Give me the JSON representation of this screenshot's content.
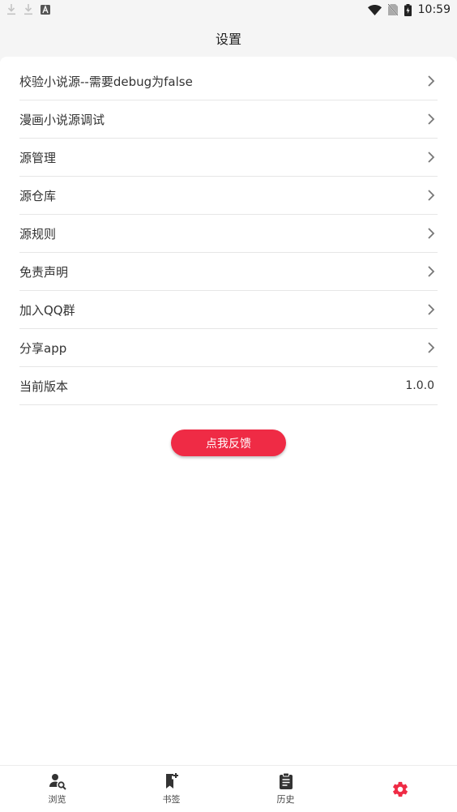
{
  "status_bar": {
    "time": "10:59",
    "left_icons": [
      "download-icon",
      "download-icon",
      "font-icon"
    ],
    "right_icons": [
      "wifi-icon",
      "no-sim-icon",
      "battery-charging-icon"
    ]
  },
  "app_bar": {
    "title": "设置"
  },
  "settings": {
    "items": [
      {
        "label": "校验小说源--需要debug为false",
        "icon": "chevron-right-icon"
      },
      {
        "label": "漫画小说源调试",
        "icon": "chevron-right-icon"
      },
      {
        "label": "源管理",
        "icon": "chevron-right-icon"
      },
      {
        "label": "源仓库",
        "icon": "chevron-right-icon"
      },
      {
        "label": "源规则",
        "icon": "chevron-right-icon"
      },
      {
        "label": "免责声明",
        "icon": "chevron-right-icon"
      },
      {
        "label": "加入QQ群",
        "icon": "chevron-right-icon"
      },
      {
        "label": "分享app",
        "icon": "chevron-right-icon"
      }
    ],
    "version": {
      "label": "当前版本",
      "value": "1.0.0"
    }
  },
  "feedback_button": {
    "label": "点我反馈",
    "color": "#ef2b45"
  },
  "bottom_nav": {
    "items": [
      {
        "label": "浏览",
        "icon": "browse-search-icon"
      },
      {
        "label": "书签",
        "icon": "bookmark-add-icon"
      },
      {
        "label": "历史",
        "icon": "clipboard-history-icon"
      },
      {
        "label": "",
        "icon": "settings-gear-icon",
        "active": true
      }
    ],
    "active_color": "#ef2b45"
  }
}
